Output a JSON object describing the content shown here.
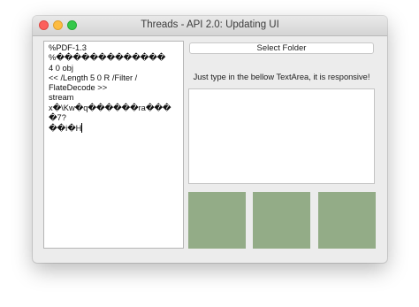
{
  "window": {
    "title": "Threads - API 2.0: Updating UI"
  },
  "editor": {
    "lines": [
      "%PDF-1.3",
      "%�������������",
      "4 0 obj",
      "<< /Length 5 0 R /Filter /",
      "FlateDecode >>",
      "stream",
      "x�\\Kw�q������ra����7?",
      "��i�H"
    ]
  },
  "select_folder_label": "Select Folder",
  "hint_text": "Just type in the bellow TextArea, it is responsive!",
  "textarea": {
    "value": ""
  },
  "colors": {
    "tile": "#93ac87"
  }
}
